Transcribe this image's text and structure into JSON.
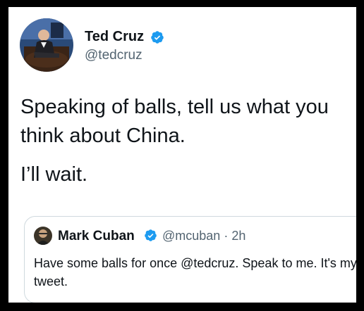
{
  "tweet": {
    "author": {
      "display_name": "Ted Cruz",
      "handle": "@tedcruz",
      "verified": true
    },
    "text_paragraph_1": "Speaking of balls, tell us what you think about China.",
    "text_paragraph_2": "I’ll wait."
  },
  "quoted_tweet": {
    "author": {
      "display_name": "Mark Cuban",
      "handle": "@mcuban",
      "verified": true
    },
    "separator": "·",
    "time": "2h",
    "text": "Have some balls for once @tedcruz. Speak to me. It's my tweet."
  },
  "colors": {
    "text_primary": "#0f1419",
    "text_secondary": "#536471",
    "verified_blue": "#1d9bf0",
    "border": "#cfd9de",
    "outer_background": "#000000"
  }
}
